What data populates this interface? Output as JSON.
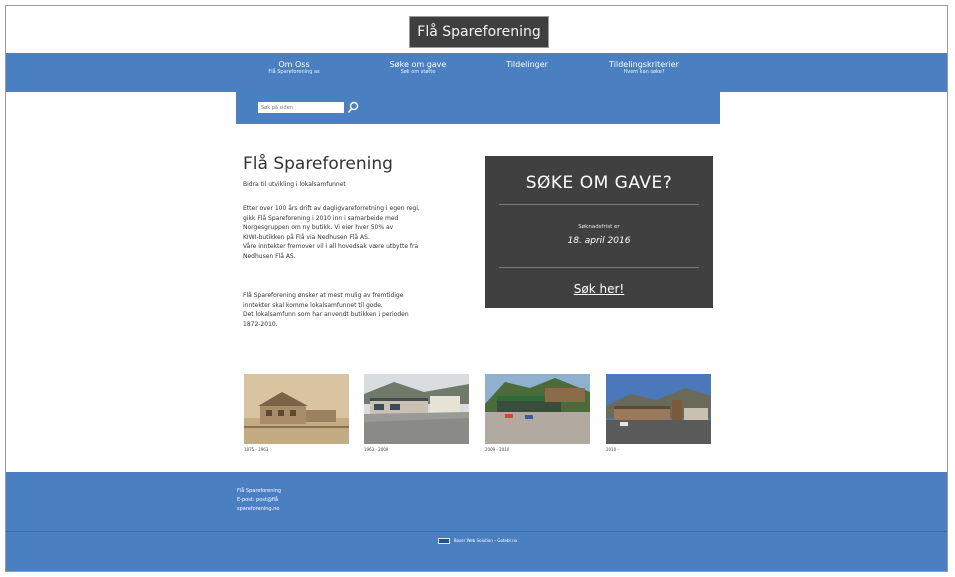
{
  "site": {
    "logo_text": "Flå Spareforening"
  },
  "nav": {
    "items": [
      {
        "title": "Om Oss",
        "subtitle": "Flå Spareforening as"
      },
      {
        "title": "Søke om gave",
        "subtitle": "Søk om støtte"
      },
      {
        "title": "Tildelinger",
        "subtitle": ""
      },
      {
        "title": "Tildelingskriterier",
        "subtitle": "Hvem kan søke?"
      }
    ]
  },
  "search": {
    "placeholder": "Søk på siden"
  },
  "main": {
    "title": "Flå Spareforening",
    "subtitle": "Bidra til utvikling i lokalsamfunnet",
    "paragraph1": [
      "Etter over 100 års drift av dagligvareforretning i egen regi,",
      "gikk Flå Spareforening i 2010 inn i samarbeide med",
      "Norgesgruppen om ny butikk. Vi eier hver 50% av",
      "KIWI-butikken på Flå via Nedhusen Flå AS.",
      "Våre inntekter fremover vil i all hovedsak være utbytte fra",
      "Nedhusen Flå AS."
    ],
    "paragraph2": [
      "Flå Spareforening ønsker at mest mulig av fremtidige",
      "inntekter skal komme lokalsamfunnet til gode.",
      "Det lokalsamfunn som har anvendt butikken i perioden",
      "1872-2010."
    ]
  },
  "cta": {
    "title": "SØKE OM GAVE?",
    "deadline_label": "Søknadsfrist er",
    "deadline": "18. april 2016",
    "link": "Søk her!"
  },
  "photos": [
    {
      "caption": "1875 - 1963"
    },
    {
      "caption": "1963 - 2009"
    },
    {
      "caption": "2009 - 2010"
    },
    {
      "caption": "2010 -"
    }
  ],
  "footer": {
    "lines": [
      "Flå Spareforening",
      "E-post: post@flå",
      "spareforening.no"
    ],
    "credit": "Boxer Web Solution – Gotebr.no"
  },
  "colors": {
    "brand_blue": "#4a7fc1",
    "dark_box": "#404040",
    "logo_bg": "#3f3f3f"
  }
}
